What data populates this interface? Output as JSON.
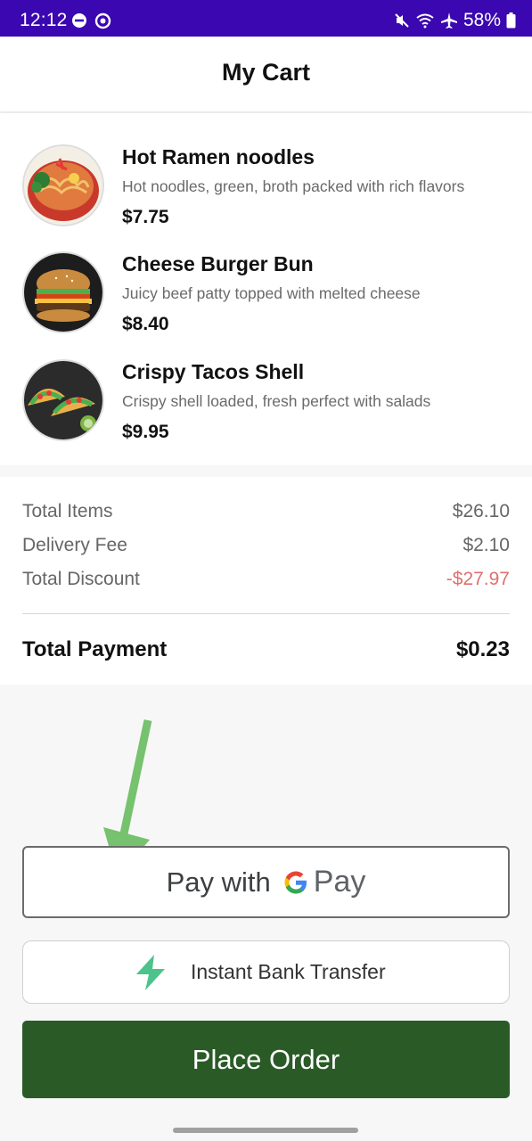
{
  "status_bar": {
    "time": "12:12",
    "battery": "58%",
    "icons": [
      "do-not-disturb-icon",
      "sync-icon",
      "mute-icon",
      "wifi-icon",
      "airplane-icon",
      "battery-icon"
    ]
  },
  "header": {
    "title": "My Cart"
  },
  "cart_items": [
    {
      "name": "Hot Ramen noodles",
      "description": "Hot noodles, green, broth packed with rich flavors",
      "price": "$7.75",
      "image": "ramen-photo"
    },
    {
      "name": "Cheese Burger Bun",
      "description": "Juicy beef patty topped with melted cheese",
      "price": "$8.40",
      "image": "burger-photo"
    },
    {
      "name": "Crispy Tacos Shell",
      "description": "Crispy shell loaded, fresh perfect with salads",
      "price": "$9.95",
      "image": "tacos-photo"
    }
  ],
  "summary": {
    "rows": [
      {
        "label": "Total Items",
        "value": "$26.10"
      },
      {
        "label": "Delivery Fee",
        "value": "$2.10"
      },
      {
        "label": "Total Discount",
        "value": "-$27.97"
      }
    ],
    "total_label": "Total Payment",
    "total_value": "$0.23"
  },
  "payment": {
    "gpay_text": "Pay with",
    "gpay_brand": "Pay",
    "bank_transfer_label": "Instant Bank Transfer",
    "place_order_label": "Place Order"
  },
  "colors": {
    "status_bar": "#3a07b0",
    "place_order": "#2a5b27",
    "discount": "#e07070",
    "arrow": "#76c26e",
    "bolt": "#4cc38a"
  }
}
